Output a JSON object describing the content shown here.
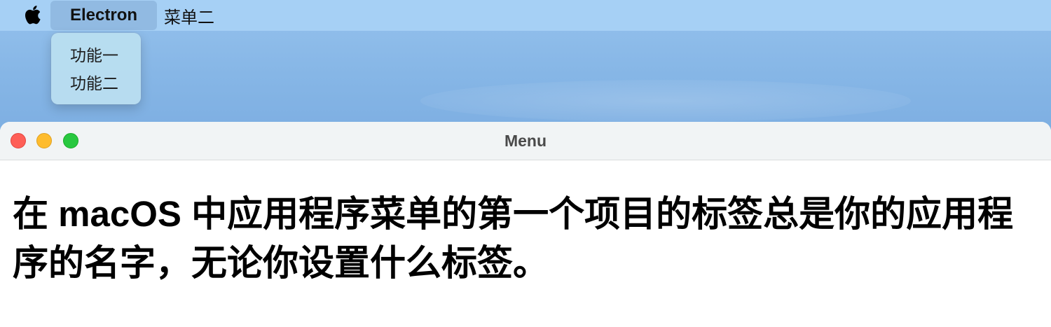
{
  "menubar": {
    "apple_icon": "apple-logo-icon",
    "app_menu_label": "Electron",
    "second_menu_label": "菜单二"
  },
  "dropdown": {
    "items": [
      {
        "label": "功能一"
      },
      {
        "label": "功能二"
      }
    ]
  },
  "window": {
    "title": "Menu",
    "controls": [
      "close-button",
      "minimize-button",
      "zoom-button"
    ],
    "heading": "在 macOS 中应用程序菜单的第一个项目的标签总是你的应用程序的名字，无论你设置什么标签。"
  },
  "colors": {
    "menubar": "#a6d0f5",
    "dropdown": "#b9def0",
    "close": "#fe5f57",
    "minimize": "#febc2e",
    "zoom": "#28c840"
  }
}
